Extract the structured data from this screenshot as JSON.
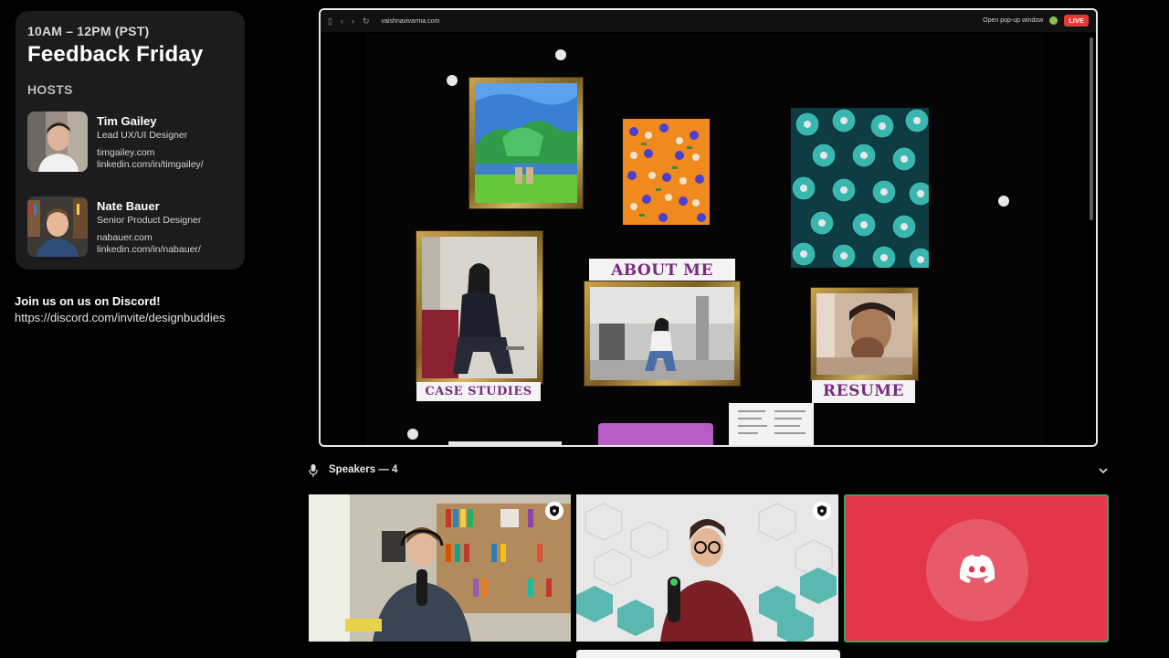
{
  "event": {
    "time": "10AM – 12PM (PST)",
    "title": "Feedback Friday",
    "hosts_label": "HOSTS"
  },
  "hosts": [
    {
      "name": "Tim Gailey",
      "role": "Lead UX/UI Designer",
      "site": "timgailey.com",
      "linkedin": "linkedin.com/in/timgailey/"
    },
    {
      "name": "Nate Bauer",
      "role": "Senior Product Designer",
      "site": "nabauer.com",
      "linkedin": "linkedin.com/in/nabauer/"
    }
  ],
  "discord_cta": {
    "title": "Join us on us on Discord!",
    "url": "https://discord.com/invite/designbuddies"
  },
  "browser": {
    "url": "vaishnavivarma.com",
    "popup_label": "Open pop-up window",
    "live_label": "LIVE"
  },
  "portfolio": {
    "about_label": "ABOUT ME",
    "case_studies_label": "CASE STUDIES",
    "resume_label": "RESUME"
  },
  "speakers": {
    "label": "Speakers — 4"
  },
  "colors": {
    "discord_red": "#e3364a",
    "live_red": "#e53935",
    "portfolio_purple": "#7a2a7e",
    "speaking_green": "#3ba55d"
  },
  "icons": [
    "mic-icon",
    "chevron-down-icon",
    "shield-icon",
    "discord-icon",
    "back-icon",
    "forward-icon",
    "reload-icon",
    "sidebar-icon"
  ]
}
